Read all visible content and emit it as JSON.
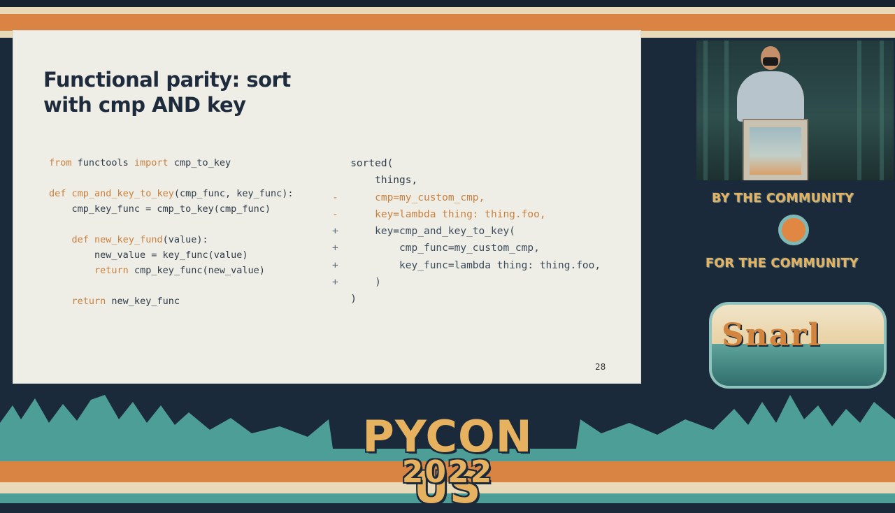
{
  "slide": {
    "title": "Functional parity: sort with cmp AND key",
    "page_number": "28",
    "code_left": [
      [
        {
          "t": "from",
          "c": "kw"
        },
        {
          "t": " functools ",
          "c": ""
        },
        {
          "t": "import",
          "c": "kw"
        },
        {
          "t": " cmp_to_key",
          "c": ""
        }
      ],
      [],
      [
        {
          "t": "def",
          "c": "kw"
        },
        {
          "t": " ",
          "c": ""
        },
        {
          "t": "cmp_and_key_to_key",
          "c": "fn"
        },
        {
          "t": "(cmp_func, key_func):",
          "c": ""
        }
      ],
      [
        {
          "t": "    cmp_key_func = cmp_to_key(cmp_func)",
          "c": ""
        }
      ],
      [],
      [
        {
          "t": "    ",
          "c": ""
        },
        {
          "t": "def",
          "c": "kw"
        },
        {
          "t": " ",
          "c": ""
        },
        {
          "t": "new_key_fund",
          "c": "fn"
        },
        {
          "t": "(value):",
          "c": ""
        }
      ],
      [
        {
          "t": "        new_value = key_func(value)",
          "c": ""
        }
      ],
      [
        {
          "t": "        ",
          "c": ""
        },
        {
          "t": "return",
          "c": "kw"
        },
        {
          "t": " cmp_key_func(new_value)",
          "c": ""
        }
      ],
      [],
      [
        {
          "t": "    ",
          "c": ""
        },
        {
          "t": "return",
          "c": "kw"
        },
        {
          "t": " new_key_func",
          "c": ""
        }
      ]
    ],
    "code_right": [
      {
        "sign": " ",
        "text": "sorted(",
        "kind": ""
      },
      {
        "sign": " ",
        "text": "    things,",
        "kind": ""
      },
      {
        "sign": "-",
        "text": "    cmp=my_custom_cmp,",
        "kind": "del"
      },
      {
        "sign": "-",
        "text": "    key=lambda thing: thing.foo,",
        "kind": "del"
      },
      {
        "sign": "+",
        "text": "    key=cmp_and_key_to_key(",
        "kind": "add"
      },
      {
        "sign": "+",
        "text": "        cmp_func=my_custom_cmp,",
        "kind": "add"
      },
      {
        "sign": "+",
        "text": "        key_func=lambda thing: thing.foo,",
        "kind": "add"
      },
      {
        "sign": "+",
        "text": "    )",
        "kind": "add"
      },
      {
        "sign": " ",
        "text": ")",
        "kind": ""
      }
    ]
  },
  "sidebar": {
    "by_community": "BY THE COMMUNITY",
    "for_community": "FOR THE COMMUNITY",
    "badge_text": "Snarl"
  },
  "event": {
    "logo_line1": "PYCON US",
    "logo_line2": "2022"
  },
  "colors": {
    "slide_bg": "#eeeee6",
    "keyword": "#c9803f",
    "text_dark": "#1e2b3c",
    "brand_orange": "#d98443",
    "brand_teal": "#4e9e98",
    "navy": "#1b2a3a"
  }
}
